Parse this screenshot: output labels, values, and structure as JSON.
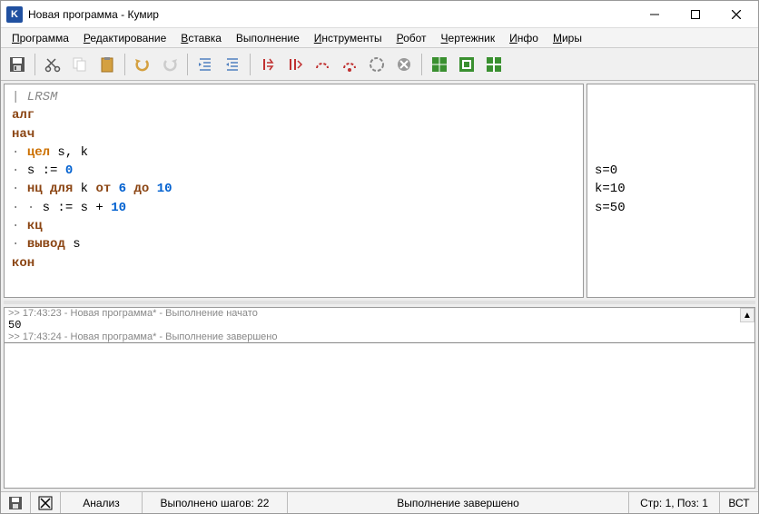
{
  "window": {
    "title": "Новая программа - Кумир"
  },
  "menu": {
    "program": "Программа",
    "edit": "Редактирование",
    "insert": "Вставка",
    "run": "Выполнение",
    "tools": "Инструменты",
    "robot": "Робот",
    "drawer": "Чертежник",
    "info": "Инфо",
    "worlds": "Миры"
  },
  "code": {
    "l1": "| LRSM",
    "l2": "алг",
    "l3": "нач",
    "l4_type": "цел",
    "l4_rest": " s, k",
    "l5_a": "s := ",
    "l5_b": "0",
    "l6_a": "нц для",
    "l6_b": " k ",
    "l6_c": "от",
    "l6_d": " ",
    "l6_e": "6",
    "l6_f": " ",
    "l6_g": "до",
    "l6_h": " ",
    "l6_i": "10",
    "l7_a": "s := s + ",
    "l7_b": "10",
    "l8": "кц",
    "l9_a": "вывод",
    "l9_b": " s",
    "l10": "кон"
  },
  "vars": {
    "v1": "s=0",
    "v2": "k=10",
    "v3": "s=50"
  },
  "output": {
    "line1": ">> 17:43:23 - Новая программа* - Выполнение начато",
    "value": "50",
    "line2": ">> 17:43:24 - Новая программа* - Выполнение завершено"
  },
  "status": {
    "analysis": "Анализ",
    "steps": "Выполнено шагов: 22",
    "state": "Выполнение завершено",
    "pos": "Стр: 1, Поз: 1",
    "mode": "ВСТ"
  }
}
